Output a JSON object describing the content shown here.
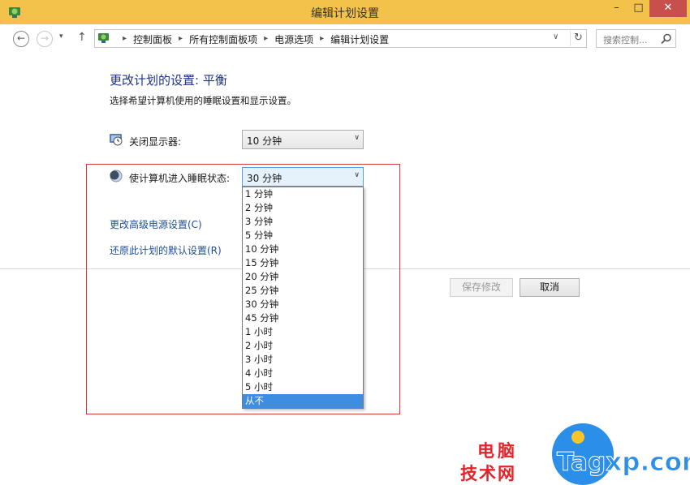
{
  "window": {
    "title": "编辑计划设置",
    "minimize": "–",
    "maximize": "□",
    "close": "✕"
  },
  "nav": {
    "back": "←",
    "forward": "→",
    "recent": "▾",
    "up": "↑",
    "breadcrumbs": [
      "控制面板",
      "所有控制面板项",
      "电源选项",
      "编辑计划设置"
    ],
    "separator": "▸",
    "dropdown": "∨",
    "refresh": "↻",
    "search_placeholder": "搜索控制..."
  },
  "content": {
    "heading": "更改计划的设置: 平衡",
    "subheading": "选择希望计算机使用的睡眠设置和显示设置。",
    "display_off": {
      "label": "关闭显示器:",
      "value": "10 分钟",
      "arrow": "∨"
    },
    "sleep": {
      "label": "使计算机进入睡眠状态:",
      "value": "30 分钟",
      "arrow": "∨",
      "options": [
        "1 分钟",
        "2 分钟",
        "3 分钟",
        "5 分钟",
        "10 分钟",
        "15 分钟",
        "20 分钟",
        "25 分钟",
        "30 分钟",
        "45 分钟",
        "1 小时",
        "2 小时",
        "3 小时",
        "4 小时",
        "5 小时",
        "从不"
      ],
      "hovered_option": "从不"
    },
    "link_advanced": "更改高级电源设置(C)",
    "link_restore": "还原此计划的默认设置(R)",
    "save_button": "保存修改",
    "cancel_button": "取消"
  },
  "watermark": {
    "line1": "电脑",
    "line2": "技术网",
    "brand": "Tagxp.com"
  },
  "colors": {
    "titlebar": "#f2c24a",
    "close_button": "#c7504c",
    "heading": "#1e3287",
    "link": "#1e4e9a",
    "selected_option": "#3d8ee0",
    "highlight_box": "#d43a3a"
  }
}
